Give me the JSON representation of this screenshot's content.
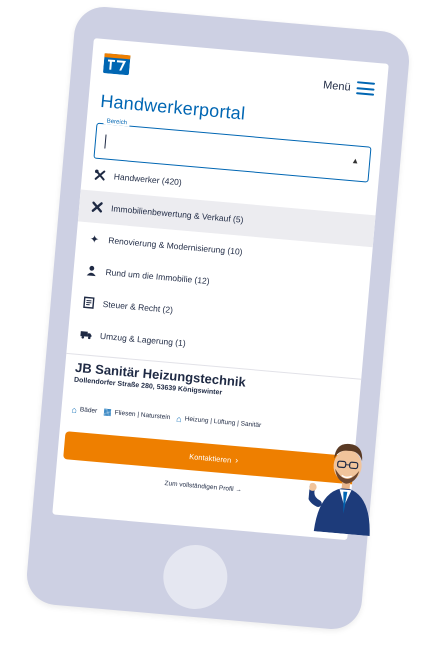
{
  "header": {
    "menu_label": "Menü"
  },
  "portal": {
    "title": "Handwerkerportal",
    "field_label": "Bereich"
  },
  "categories": [
    {
      "label": "Handwerker (420)",
      "icon": "tools-icon"
    },
    {
      "label": "Immobilienbewertung & Verkauf (5)",
      "icon": "crossed-tools-icon"
    },
    {
      "label": "Renovierung & Modernisierung (10)",
      "icon": "sparkle-icon"
    },
    {
      "label": "Rund um die Immobilie (12)",
      "icon": "person-house-icon"
    },
    {
      "label": "Steuer & Recht (2)",
      "icon": "document-icon"
    },
    {
      "label": "Umzug & Lagerung (1)",
      "icon": "truck-icon"
    }
  ],
  "company": {
    "name": "JB Sanitär Heizungstechnik",
    "address": "Dollendorfer Straße 280, 53639 Königswinter",
    "tags": [
      {
        "label": "Bäder",
        "icon": "house-icon"
      },
      {
        "label": "Fliesen | Naturstein",
        "icon": "tiles-icon"
      },
      {
        "label": "Heizung | Lüftung | Sanitär",
        "icon": "heater-icon"
      }
    ]
  },
  "actions": {
    "contact_label": "Kontaktieren",
    "profile_link": "Zum vollständigen Profil →"
  },
  "colors": {
    "brand_blue": "#0066b3",
    "accent_orange": "#ee7f00",
    "device_frame": "#cdd0e3"
  }
}
